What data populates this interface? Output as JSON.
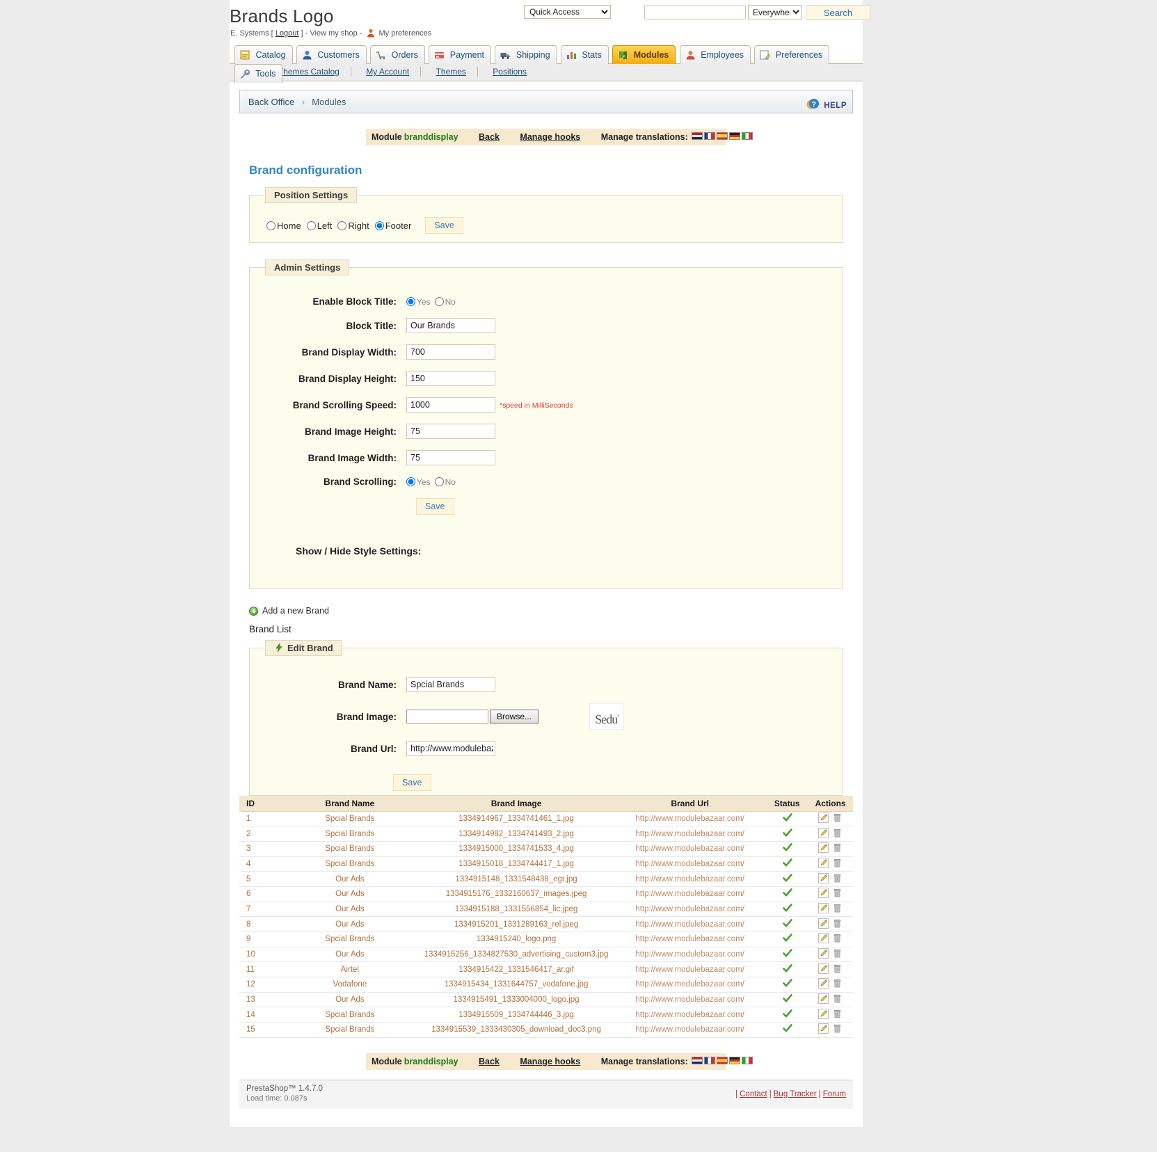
{
  "header": {
    "site_title": "Brands Logo",
    "user_prefix": "E. Systems [",
    "logout": "Logout",
    "user_mid": "] - View my shop -",
    "preferences": "My preferences",
    "quick_access_label": "Quick Access",
    "search_value": "",
    "search_placeholder": "",
    "scope_label": "Everywhere",
    "search_button": "Search"
  },
  "tabs": [
    {
      "label": "Catalog",
      "icon": "catalog-icon",
      "active": false
    },
    {
      "label": "Customers",
      "icon": "customers-icon",
      "active": false
    },
    {
      "label": "Orders",
      "icon": "orders-icon",
      "active": false
    },
    {
      "label": "Payment",
      "icon": "payment-icon",
      "active": false
    },
    {
      "label": "Shipping",
      "icon": "shipping-icon",
      "active": false
    },
    {
      "label": "Stats",
      "icon": "stats-icon",
      "active": false
    },
    {
      "label": "Modules",
      "icon": "modules-icon",
      "active": true
    },
    {
      "label": "Employees",
      "icon": "employees-icon",
      "active": false
    },
    {
      "label": "Preferences",
      "icon": "preferences-icon",
      "active": false
    },
    {
      "label": "Tools",
      "icon": "tools-icon",
      "active": false
    }
  ],
  "subnav": [
    {
      "label": "Modules & Themes Catalog"
    },
    {
      "label": "My Account"
    },
    {
      "label": "Themes"
    },
    {
      "label": "Positions"
    }
  ],
  "breadcrumb": {
    "root": "Back Office",
    "separator": "›",
    "leaf": "Modules",
    "help": "HELP"
  },
  "module_strip": {
    "module_word": "Module",
    "module_name": "branddisplay",
    "back": "Back",
    "manage_hooks": "Manage hooks",
    "manage_translations": "Manage translations:",
    "flags": [
      "en",
      "fr",
      "es",
      "de",
      "it"
    ]
  },
  "page_title": "Brand configuration",
  "position_settings": {
    "legend": "Position Settings",
    "options": [
      {
        "label": "Home",
        "checked": false
      },
      {
        "label": "Left",
        "checked": false
      },
      {
        "label": "Right",
        "checked": false
      },
      {
        "label": "Footer",
        "checked": true
      }
    ],
    "save_label": "Save"
  },
  "admin_settings": {
    "legend": "Admin Settings",
    "fields": [
      {
        "label": "Enable Block Title:",
        "type": "radio",
        "yes": "Yes",
        "no": "No",
        "value": "Yes"
      },
      {
        "label": "Block Title:",
        "type": "text",
        "value": "Our Brands"
      },
      {
        "label": "Brand Display Width:",
        "type": "text",
        "value": "700"
      },
      {
        "label": "Brand Display Height:",
        "type": "text",
        "value": "150"
      },
      {
        "label": "Brand Scrolling Speed:",
        "type": "text",
        "value": "1000",
        "hint": "*speed in MilliSeconds"
      },
      {
        "label": "Brand Image Height:",
        "type": "text",
        "value": "75"
      },
      {
        "label": "Brand Image Width:",
        "type": "text",
        "value": "75"
      },
      {
        "label": "Brand Scrolling:",
        "type": "radio",
        "yes": "Yes",
        "no": "No",
        "value": "Yes"
      }
    ],
    "save_label": "Save",
    "style_toggle": "Show / Hide Style Settings:"
  },
  "add_new_brand": "Add a new Brand",
  "brand_list_title": "Brand List",
  "edit_brand": {
    "legend": "Edit Brand",
    "name_label": "Brand Name:",
    "name_value": "Spcial Brands",
    "image_label": "Brand Image:",
    "image_value": "",
    "browse_label": "Browse...",
    "preview_text": "Sedu",
    "preview_sup": "°",
    "url_label": "Brand Url:",
    "url_value": "http://www.modulebaza",
    "save_label": "Save"
  },
  "table": {
    "columns": [
      "ID",
      "Brand Name",
      "Brand Image",
      "Brand Url",
      "Status",
      "Actions"
    ],
    "rows": [
      {
        "id": "1",
        "name": "Spcial Brands",
        "image": "1334914967_1334741461_1.jpg",
        "url": "http://www.modulebazaar.com/",
        "status": "active"
      },
      {
        "id": "2",
        "name": "Spcial Brands",
        "image": "1334914982_1334741493_2.jpg",
        "url": "http://www.modulebazaar.com/",
        "status": "active"
      },
      {
        "id": "3",
        "name": "Spcial Brands",
        "image": "1334915000_1334741533_4.jpg",
        "url": "http://www.modulebazaar.com/",
        "status": "active"
      },
      {
        "id": "4",
        "name": "Spcial Brands",
        "image": "1334915018_1334744417_1.jpg",
        "url": "http://www.modulebazaar.com/",
        "status": "active"
      },
      {
        "id": "5",
        "name": "Our Ads",
        "image": "1334915148_1331548438_egr.jpg",
        "url": "http://www.modulebazaar.com/",
        "status": "active"
      },
      {
        "id": "6",
        "name": "Our Ads",
        "image": "1334915176_1332160637_images.jpeg",
        "url": "http://www.modulebazaar.com/",
        "status": "active"
      },
      {
        "id": "7",
        "name": "Our Ads",
        "image": "1334915188_1331556854_lic.jpeg",
        "url": "http://www.modulebazaar.com/",
        "status": "active"
      },
      {
        "id": "8",
        "name": "Our Ads",
        "image": "1334915201_1331289163_rel.jpeg",
        "url": "http://www.modulebazaar.com/",
        "status": "active"
      },
      {
        "id": "9",
        "name": "Spcial Brands",
        "image": "1334915240_logo.png",
        "url": "http://www.modulebazaar.com/",
        "status": "active"
      },
      {
        "id": "10",
        "name": "Our Ads",
        "image": "1334915256_1334827530_advertising_custom3.jpg",
        "url": "http://www.modulebazaar.com/",
        "status": "active"
      },
      {
        "id": "11",
        "name": "Airtel",
        "image": "1334915422_1331546417_ar.gif",
        "url": "http://www.modulebazaar.com/",
        "status": "active"
      },
      {
        "id": "12",
        "name": "Vodafone",
        "image": "1334915434_1331644757_vodafone.jpg",
        "url": "http://www.modulebazaar.com/",
        "status": "active"
      },
      {
        "id": "13",
        "name": "Our Ads",
        "image": "1334915491_1333004000_logo.jpg",
        "url": "http://www.modulebazaar.com/",
        "status": "active"
      },
      {
        "id": "14",
        "name": "Spcial Brands",
        "image": "1334915509_1334744446_3.jpg",
        "url": "http://www.modulebazaar.com/",
        "status": "active"
      },
      {
        "id": "15",
        "name": "Spcial Brands",
        "image": "1334915539_1333430305_download_doc3.png",
        "url": "http://www.modulebazaar.com/",
        "status": "active"
      }
    ]
  },
  "footer": {
    "version": "PrestaShop™ 1.4.7.0",
    "load_time": "Load time: 0.087s",
    "links": [
      "Contact",
      "Bug Tracker",
      "Forum"
    ]
  },
  "colors": {
    "accent": "#f2ad18",
    "panel_bg": "#fdfdee",
    "legend_bg": "#f7efd7",
    "table_header": "#f2e6cf",
    "link": "#23527c",
    "module_green": "#1a7d1a",
    "row_text": "#b4713c"
  }
}
